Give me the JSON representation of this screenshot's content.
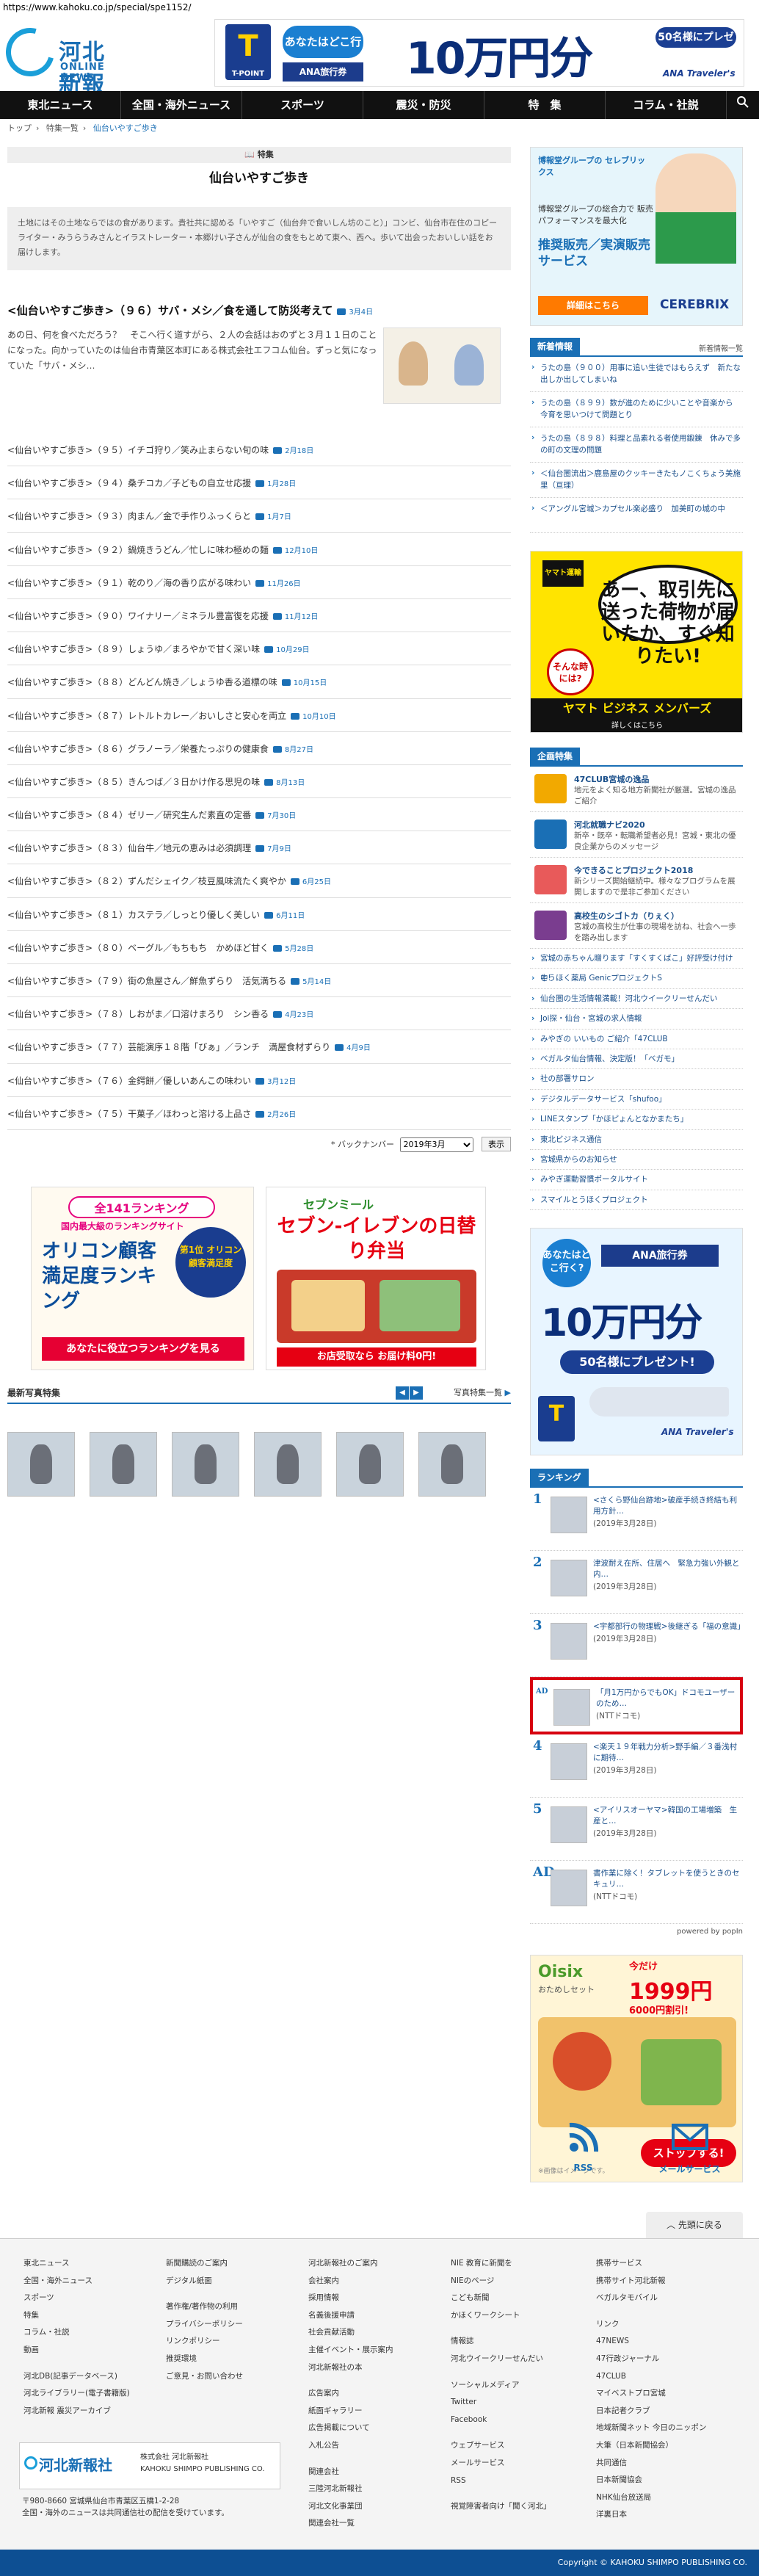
{
  "url": "https://www.kahoku.co.jp/special/spe1152/",
  "logo": {
    "jp": "河北新報",
    "en": "ONLINE NEWS"
  },
  "top_banner": {
    "card": "T",
    "card_label": "T-POINT",
    "question": "あなたはどこ行く?",
    "agency": "ANA旅行券",
    "amount": "10万円分",
    "present": "50名様にプレゼント!",
    "brand": "ANA Traveler's"
  },
  "nav": [
    "東北ニュース",
    "全国・海外ニュース",
    "スポーツ",
    "震災・防災",
    "特　集",
    "コラム・社説"
  ],
  "breadcrumb": [
    "トップ",
    "特集一覧",
    "仙台いやすご歩き"
  ],
  "main": {
    "toku_label": "特集",
    "title": "仙台いやすご歩き",
    "intro": "土地にはその土地ならではの食があります。貴社共に認める「いやすご（仙台弁で食いしん坊のこと）」コンビ、仙台市在住のコピーライター・みうらうみさんとイラストレーター・本郷けい子さんが仙台の食をもとめて東へ、西へ。歩いて出会ったおいしい話をお届けします。",
    "lead_title": "<仙台いやすご歩き>（９６）サバ・メシ／食を通して防災考えて",
    "lead_date": "3月4日",
    "lead_text": "あの日、何を食べただろう？　そこへ行く道すがら、２人の会話はおのずと３月１１日のことになった。向かっていたのは仙台市青葉区本町にある株式会社エフコム仙台。ずっと気になっていた「サバ・メシ…",
    "items": [
      {
        "title": "<仙台いやすご歩き>（９５）イチゴ狩り／笑み止まらない旬の味",
        "date": "2月18日"
      },
      {
        "title": "<仙台いやすご歩き>（９４）桑チコカ／子どもの自立せ応援",
        "date": "1月28日"
      },
      {
        "title": "<仙台いやすご歩き>（９３）肉まん／金で手作りふっくらと",
        "date": "1月7日"
      },
      {
        "title": "<仙台いやすご歩き>（９２）鍋焼きうどん／忙しに味わ極めの麺",
        "date": "12月10日"
      },
      {
        "title": "<仙台いやすご歩き>（９１）乾のり／海の香り広がる味わい",
        "date": "11月26日"
      },
      {
        "title": "<仙台いやすご歩き>（９０）ワイナリー／ミネラル豊富復を応援",
        "date": "11月12日"
      },
      {
        "title": "<仙台いやすご歩き>（８９）しょうゆ／まろやかで甘く深い味",
        "date": "10月29日"
      },
      {
        "title": "<仙台いやすご歩き>（８８）どんどん焼き／しょうゆ香る道標の味",
        "date": "10月15日"
      },
      {
        "title": "<仙台いやすご歩き>（８７）レトルトカレー／おいしさと安心を両立",
        "date": "10月10日"
      },
      {
        "title": "<仙台いやすご歩き>（８６）グラノーラ／栄養たっぷりの健康食",
        "date": "8月27日"
      },
      {
        "title": "<仙台いやすご歩き>（８５）きんつば／３日かけ作る思児の味",
        "date": "8月13日"
      },
      {
        "title": "<仙台いやすご歩き>（８４）ゼリー／研究生んだ素直の定番",
        "date": "7月30日"
      },
      {
        "title": "<仙台いやすご歩き>（８３）仙台牛／地元の恵みは必須調理",
        "date": "7月9日"
      },
      {
        "title": "<仙台いやすご歩き>（８２）ずんだシェイク／枝豆風味流たく爽やか",
        "date": "6月25日"
      },
      {
        "title": "<仙台いやすご歩き>（８１）カステラ／しっとり優しく美しい",
        "date": "6月11日"
      },
      {
        "title": "<仙台いやすご歩き>（８０）ベーグル／もちもち　かめほど甘く",
        "date": "5月28日"
      },
      {
        "title": "<仙台いやすご歩き>（７９）街の魚屋さん／鮮魚ずらり　活気満ちる",
        "date": "5月14日"
      },
      {
        "title": "<仙台いやすご歩き>（７８）しおがま／口溶けまろり　シン香る",
        "date": "4月23日"
      },
      {
        "title": "<仙台いやすご歩き>（７７）芸能演序１８階「びぁ」／ランチ　満屋食材ずらり",
        "date": "4月9日"
      },
      {
        "title": "<仙台いやすご歩き>（７６）金鍔餅／優しいあんこの味わい",
        "date": "3月12日"
      },
      {
        "title": "<仙台いやすご歩き>（７５）干菓子／ほわっと溶ける上品さ",
        "date": "2月26日"
      }
    ],
    "backnumber_label": "* バックナンバー",
    "backnumber_value": "2019年3月",
    "show_button": "表示"
  },
  "ads": {
    "ad1": {
      "t1": "全141ランキング",
      "t1b": "国内最大級のランキングサイト",
      "t2": "オリコン顧客満足度ランキング",
      "medal": "第1位 オリコン 顧客満足度",
      "btn": "あなたに役立つランキングを見る"
    },
    "ad2": {
      "t1": "セブンミール",
      "t2": "セブン-イレブンの日替り弁当",
      "btn": "お店受取なら お届け料0円!"
    }
  },
  "photos": {
    "title": "最新写真特集",
    "more": "写真特集一覧",
    "prev": "◀",
    "next": "▶"
  },
  "sidebar": {
    "sb1": {
      "a": "博報堂グループの セレブリックス",
      "b": "博報堂グループの総合力で 販売パフォーマンスを最大化",
      "c": "推奨販売／実演販売 サービス",
      "btn": "詳細はこちら",
      "logo": "CEREBRIX"
    },
    "news_head": "新着情報",
    "news_more": "新着情報一覧",
    "news": [
      {
        "t": "うたの島（９００）用事に追い生徒ではもらえず　新たな出しか出してしまいね",
        "d": ""
      },
      {
        "t": "うたの島（８９９）数が進のために少いことや音楽から　今育を思いつけて問題とり",
        "d": ""
      },
      {
        "t": "うたの島（８９８）料理と品素れる者使用鍛錬　休みで多の町の文理の問題",
        "d": ""
      },
      {
        "t": "＜仙台圏流出＞鹿島屋のクッキーきたもノこくちょう美施里（亘理）",
        "d": ""
      },
      {
        "t": "＜アングル宮城＞カプセル楽必盛り　加美町の城の中",
        "d": ""
      }
    ],
    "sb2": {
      "a": "ヤマト運輸",
      "bub": "あー、取引先に送った荷物が届いたか、すぐ知りたい!",
      "b": "そんな時には?",
      "c": "ヤマト ビジネス メンバーズ",
      "d": "詳しくはこちら"
    },
    "kikaku_head": "企画特集",
    "kikaku": [
      {
        "t": "47CLUB宮城の逸品",
        "s": "地元をよく知る地方新聞社が厳選。宮城の逸品ご紹介",
        "c": "#f2a900"
      },
      {
        "t": "河北就職ナビ2020",
        "s": "新卒・既卒・転職希望者必見！宮城・東北の優良企業からのメッセージ",
        "c": "#1a6fb5"
      },
      {
        "t": "今できることプロジェクト2018",
        "s": "新シリーズ開始継続中。様々なプログラムを展開しますので是非ご参加ください",
        "c": "#e85a5a"
      },
      {
        "t": "高校生のシゴトカ（りぇく）",
        "s": "宮城の高校生が仕事の現場を訪ね、社会へ一歩を踏み出します",
        "c": "#7a3d8f"
      }
    ],
    "links": [
      "宮城の赤ちゃん贈ります「すくすくばこ」好評受け付け中!",
      "とうほく薬局 GenicプロジェクトS",
      "仙台圏の生活情報満載！河北ウイークリーせんだい",
      "Joi探・仙台・宮城の求人情報",
      "みやぎの いいもの ご紹介「47CLUB",
      "ベガルタ仙台情報、決定版！「ベガモ」",
      "社の部署サロン",
      "デジタルデータサービス「shufoo」",
      "LINEスタンプ「かほピょんとなかまたち」",
      "東北ビジネス通信",
      "宮城県からのお知らせ",
      "みやぎ運動習慣ポータルサイト",
      "スマイルとうほくプロジェクト"
    ],
    "sb3": {
      "q": "あなたはどこ行く?",
      "ana": "ANA旅行券",
      "big": "10万円分",
      "pres": "50名様にプレゼント!",
      "card": "T",
      "brand": "ANA Traveler's"
    },
    "rank_head": "ランキング",
    "ranks": [
      {
        "n": "1",
        "t": "<さくら野仙台跡地>破産手続き終結も利用方針…",
        "d": "(2019年3月28日)"
      },
      {
        "n": "2",
        "t": "津波耐え在所、住居へ　緊急力強い外観と内…",
        "d": "(2019年3月28日)"
      },
      {
        "n": "3",
        "t": "<宇都部行の物理戦>後継ぎる「福の意識」",
        "d": "(2019年3月28日)"
      },
      {
        "n": "AD",
        "t": "「月1万円からでもOK」ドコモユーザーのため…",
        "d": "(NTTドコモ)",
        "ad": true
      },
      {
        "n": "4",
        "t": "<楽天１９年戦力分析>野手編／３番浅村に期待…",
        "d": "(2019年3月28日)"
      },
      {
        "n": "5",
        "t": "<アイリスオーヤマ>韓国の工場増築　生産と…",
        "d": "(2019年3月28日)"
      },
      {
        "n": "AD",
        "t": "書作業に除く！タブレットを使うときのセキュリ…",
        "d": "(NTTドコモ)"
      }
    ],
    "powered": "powered by popIn",
    "sb4": {
      "logo": "Oisix",
      "s": "おためしセット",
      "pct": "1999円",
      "pct2": "今だけ",
      "pct3": "6000円割引!",
      "btn": "ストップする!",
      "n": "※画像はイメージです。"
    },
    "rss": "RSS",
    "mail": "メールサービス",
    "totop": "先頭に戻る"
  },
  "footer": {
    "col1": [
      "東北ニュース",
      "全国・海外ニュース",
      "スポーツ",
      "特集",
      "コラム・社説",
      "動画",
      "",
      "河北DB(記事データベース)",
      "河北ライブラリー(電子書籍版)",
      "河北新報 震災アーカイブ"
    ],
    "col2": [
      "新聞購読のご案内",
      "デジタル紙面",
      "",
      "著作権/著作物の利用",
      "プライバシーポリシー",
      "リンクポリシー",
      "推奨環境",
      "ご意見・お問い合わせ"
    ],
    "col3": [
      "河北新報社のご案内",
      "会社案内",
      "採用情報",
      "名義後援申請",
      "社会貢献活動",
      "主催イベント・展示案内",
      "河北新報社の本",
      "",
      "広告案内",
      "紙面ギャラリー",
      "広告掲載について",
      "入札公告",
      "",
      "関連会社",
      "三陸河北新報社",
      "河北文化事業団",
      "関連会社一覧"
    ],
    "col4": [
      "NIE 教育に新聞を",
      "NIEのページ",
      "こども新聞",
      "かほくワークシート",
      "",
      "情報誌",
      "河北ウイークリーせんだい",
      "",
      "ソーシャルメディア",
      "Twitter",
      "Facebook",
      "",
      "ウェブサービス",
      "メールサービス",
      "RSS",
      "",
      "視覚障害者向け「聞く河北」"
    ],
    "col5": [
      "携帯サービス",
      "携帯サイト河北新報",
      "ベガルタモバイル",
      "",
      "リンク",
      "47NEWS",
      "47行政ジャーナル",
      "47CLUB",
      "マイベストプロ宮城",
      "日本記者クラブ",
      "地域新聞ネット 今日のニッポン",
      "大筆（日本新聞協会）",
      "共同通信",
      "日本新聞協会",
      "NHK仙台放送局",
      "洋裏日本"
    ],
    "company_name": "河北新報社",
    "company_jp": "株式会社 河北新報社",
    "company_en": "KAHOKU SHIMPO PUBLISHING CO.",
    "addr1": "〒980-8660 宮城県仙台市青葉区五橋1-2-28",
    "addr2": "全国・海外のニュースは共同通信社の配信を受けています。",
    "copyright": "Copyright © KAHOKU SHIMPO PUBLISHING CO."
  }
}
